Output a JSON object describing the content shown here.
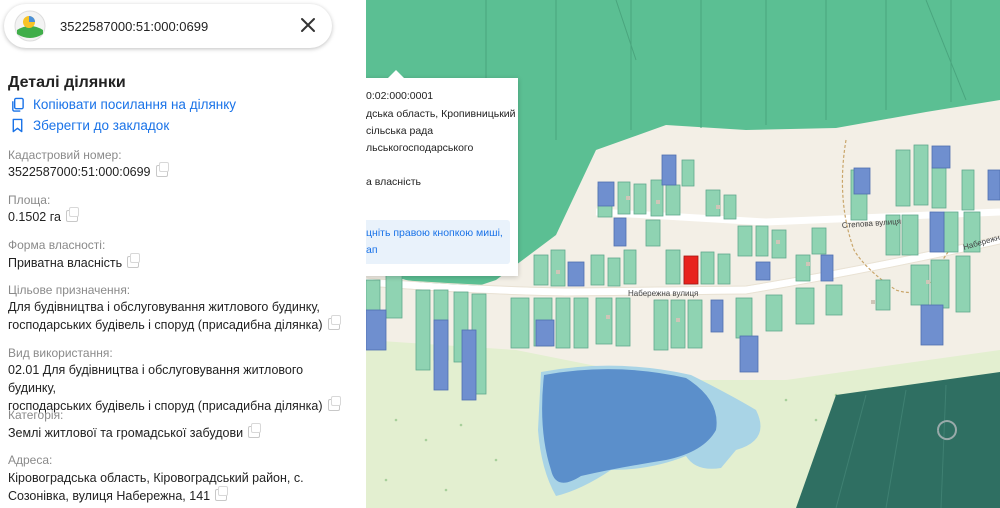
{
  "search": {
    "value": "3522587000:51:000:0699"
  },
  "details": {
    "title": "Деталі ділянки",
    "copy_link": "Копіювати посилання на ділянку",
    "bookmark": "Зберегти до закладок",
    "fields": {
      "cadastral_label": "Кадастровий номер:",
      "cadastral_value": "3522587000:51:000:0699",
      "area_label": "Площа:",
      "area_value": "0.1502 га",
      "ownership_label": "Форма власності:",
      "ownership_value": "Приватна власність",
      "purpose_label": "Цільове призначення:",
      "purpose_line1": "Для будівництва і обслуговування житлового будинку,",
      "purpose_line2": "господарських будівель і споруд (присадибна ділянка)",
      "usage_label": "Вид використання:",
      "usage_line1": "02.01 Для будівництва і обслуговування житлового будинку,",
      "usage_line2": "господарських будівель і споруд (присадибна ділянка)",
      "category_label": "Категорія:",
      "category_value": "Землі житлової та громадської забудови",
      "address_label": "Адреса:",
      "address_line1": "Кіровоградська область, Кіровоградський район, с.",
      "address_line2": "Созонівка, вулиця Набережна, 141"
    }
  },
  "map": {
    "popup": {
      "line1": "0:02:000:0001",
      "line2": "дська область, Кропивницький",
      "line3": "сільська рада",
      "line4": "льськогосподарського",
      "line5": "а власність",
      "hint1": "цніть правою кнопкою миші,",
      "hint2": "ап"
    },
    "streets": {
      "naberezhna": "Набережна вулиця",
      "stepova": "Степова вулиця",
      "naberezhna_right": "Набережна"
    },
    "colors": {
      "green_zone": "#5bbf93",
      "parcel_green": "#8fd3b2",
      "parcel_blue": "#6f8fcf",
      "selected": "#e8231e",
      "lake": "#5b8fcb",
      "forest": "#2f6f62"
    }
  }
}
